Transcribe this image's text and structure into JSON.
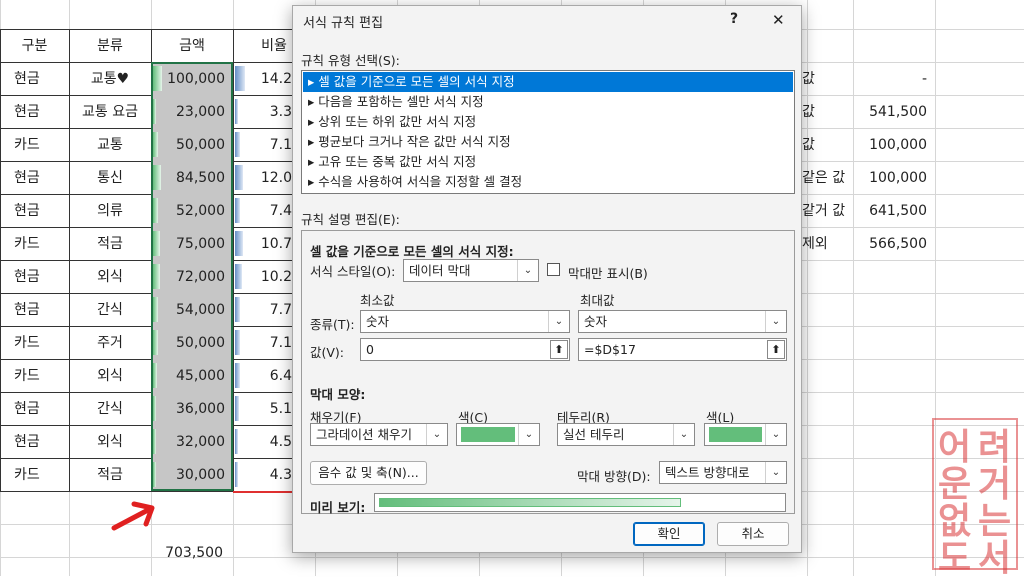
{
  "spreadsheet": {
    "headers": [
      "구분",
      "분류",
      "금액",
      "비율"
    ],
    "rows": [
      {
        "type": "현금",
        "category": "교통♥",
        "amount": "100,000",
        "ratio": "14.2",
        "bar": 1.0
      },
      {
        "type": "현금",
        "category": "교통 요금",
        "amount": "23,000",
        "ratio": "3.3",
        "bar": 0.23
      },
      {
        "type": "카드",
        "category": "교통",
        "amount": "50,000",
        "ratio": "7.1",
        "bar": 0.5
      },
      {
        "type": "현금",
        "category": "통신",
        "amount": "84,500",
        "ratio": "12.0",
        "bar": 0.845
      },
      {
        "type": "현금",
        "category": "의류",
        "amount": "52,000",
        "ratio": "7.4",
        "bar": 0.52
      },
      {
        "type": "카드",
        "category": "적금",
        "amount": "75,000",
        "ratio": "10.7",
        "bar": 0.75
      },
      {
        "type": "현금",
        "category": "외식",
        "amount": "72,000",
        "ratio": "10.2",
        "bar": 0.72
      },
      {
        "type": "현금",
        "category": "간식",
        "amount": "54,000",
        "ratio": "7.7",
        "bar": 0.54
      },
      {
        "type": "카드",
        "category": "주거",
        "amount": "50,000",
        "ratio": "7.1",
        "bar": 0.5
      },
      {
        "type": "카드",
        "category": "외식",
        "amount": "45,000",
        "ratio": "6.4",
        "bar": 0.45
      },
      {
        "type": "현금",
        "category": "간식",
        "amount": "36,000",
        "ratio": "5.1",
        "bar": 0.36
      },
      {
        "type": "현금",
        "category": "외식",
        "amount": "32,000",
        "ratio": "4.5",
        "bar": 0.32
      },
      {
        "type": "카드",
        "category": "적금",
        "amount": "30,000",
        "ratio": "4.3",
        "bar": 0.3
      }
    ],
    "total": "703,500",
    "summary": [
      {
        "label": "값",
        "value": "-"
      },
      {
        "label": "값",
        "value": "541,500"
      },
      {
        "label": "값",
        "value": "100,000"
      },
      {
        "label": "같은 값",
        "value": "100,000"
      },
      {
        "label": "같거 값",
        "value": "641,500"
      },
      {
        "label": "제외",
        "value": "566,500"
      }
    ]
  },
  "dialog": {
    "title": "서식 규칙 편집",
    "help": "?",
    "close": "✕",
    "rule_type_label": "규칙 유형 선택(S):",
    "rule_types": [
      "▸ 셀 값을 기준으로 모든 셀의 서식 지정",
      "▸ 다음을 포함하는 셀만 서식 지정",
      "▸ 상위 또는 하위 값만 서식 지정",
      "▸ 평균보다 크거나 작은 값만 서식 지정",
      "▸ 고유 또는 중복 값만 서식 지정",
      "▸ 수식을 사용하여 서식을 지정할 셀 결정"
    ],
    "rule_desc_label": "규칙 설명 편집(E):",
    "desc_heading": "셀 값을 기준으로 모든 셀의 서식 지정:",
    "format_style_label": "서식 스타일(O):",
    "format_style_value": "데이터 막대",
    "bar_only_label": "막대만 표시(B)",
    "min_label": "최소값",
    "max_label": "최대값",
    "type_label": "종류(T):",
    "min_type": "숫자",
    "max_type": "숫자",
    "value_label": "값(V):",
    "min_value": "0",
    "max_value": "=$D$17",
    "bar_appearance_label": "막대 모양:",
    "fill_label": "채우기(F)",
    "fill_value": "그라데이션 채우기",
    "fill_color_label": "색(C)",
    "border_label": "테두리(R)",
    "border_value": "실선 테두리",
    "border_color_label": "색(L)",
    "bar_color": "#63be7b",
    "negative_button": "음수 값 및 축(N)...",
    "direction_label": "막대 방향(D):",
    "direction_value": "텍스트 방향대로",
    "preview_label": "미리 보기:",
    "ok": "확인",
    "cancel": "취소"
  },
  "stamp": {
    "text": "어려운 거 없는 도서"
  }
}
